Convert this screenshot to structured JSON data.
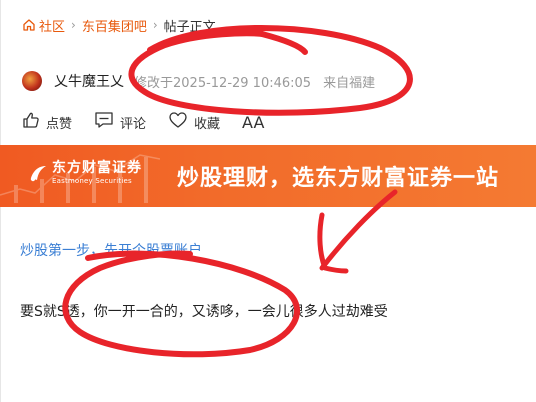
{
  "breadcrumb": {
    "home_label": "社区",
    "forum_label": "东百集团吧",
    "current_label": "帖子正文"
  },
  "post_meta": {
    "author_name": "乂牛魔王乂",
    "edit_time": "修改于2025-12-29 10:46:05",
    "location": "来自福建"
  },
  "actions": {
    "like_label": "点赞",
    "comment_label": "评论",
    "favorite_label": "收藏",
    "font_size_label": "AA"
  },
  "banner": {
    "brand_cn": "东方财富证券",
    "brand_en": "Eastmoney Securities",
    "slogan": "炒股理财，选东方财富证券一站"
  },
  "content": {
    "promo_link": "炒股第一步，先开个股票账户",
    "body_text": "要S就S透，你一开一合的，又诱哆，一会儿很多人过劫难受"
  },
  "colors": {
    "accent_orange": "#e8590c",
    "banner_orange": "#f26b2a",
    "link_blue": "#3b7fd4",
    "annotation_red": "#e8242a"
  },
  "icons": [
    "home-icon",
    "avatar",
    "thumbs-up-icon",
    "comment-icon",
    "heart-icon",
    "font-size-icon",
    "eastmoney-logo-icon"
  ]
}
